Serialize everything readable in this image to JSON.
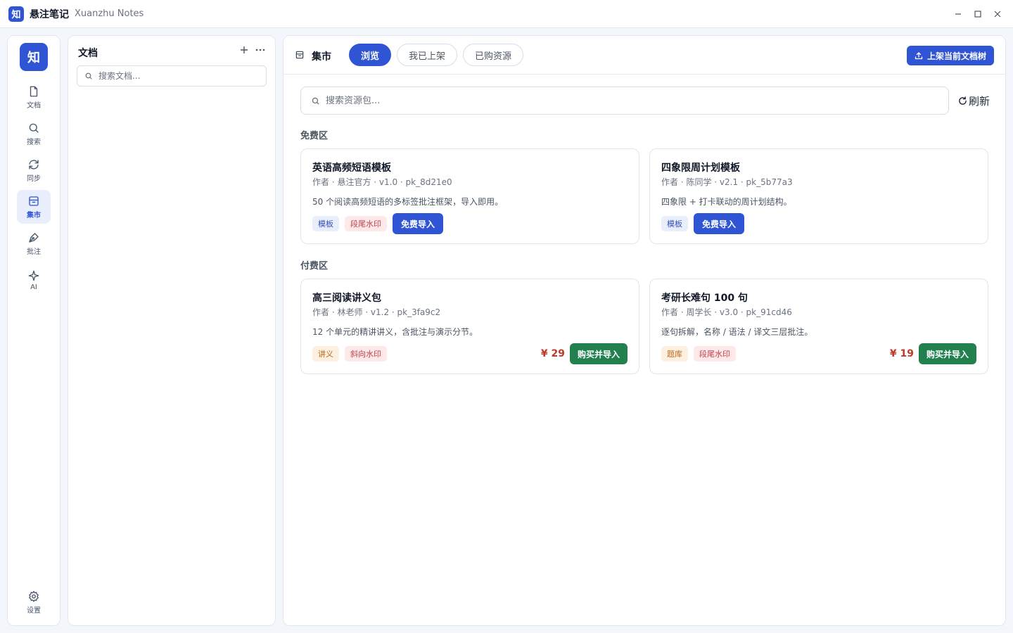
{
  "titlebar": {
    "logo_char": "知",
    "app_name": "悬注笔记",
    "app_subtitle": "Xuanzhu Notes"
  },
  "rail": {
    "logo_char": "知",
    "items": [
      {
        "label": "文档",
        "icon": "document-icon",
        "active": false
      },
      {
        "label": "搜索",
        "icon": "search-icon",
        "active": false
      },
      {
        "label": "同步",
        "icon": "sync-icon",
        "active": false
      },
      {
        "label": "集市",
        "icon": "market-icon",
        "active": true
      },
      {
        "label": "批注",
        "icon": "annotate-pen-icon",
        "active": false
      },
      {
        "label": "AI",
        "icon": "sparkle-icon",
        "active": false
      }
    ],
    "settings_label": "设置"
  },
  "docs": {
    "title": "文档",
    "search_placeholder": "搜索文档..."
  },
  "market": {
    "title": "集市",
    "tabs": [
      {
        "label": "浏览",
        "active": true
      },
      {
        "label": "我已上架",
        "active": false
      },
      {
        "label": "已购资源",
        "active": false
      }
    ],
    "publish_label": "上架当前文档树",
    "search_placeholder": "搜索资源包...",
    "refresh_label": "刷新",
    "free_section": {
      "label": "免费区",
      "cards": [
        {
          "title": "英语高频短语模板",
          "meta": "作者 · 悬注官方 · v1.0 · pk_8d21e0",
          "desc": "50 个阅读高频短语的多标签批注框架，导入即用。",
          "tags": [
            {
              "text": "模板",
              "color": "blue"
            },
            {
              "text": "段尾水印",
              "color": "red"
            }
          ],
          "button": "免费导入"
        },
        {
          "title": "四象限周计划模板",
          "meta": "作者 · 陈同学 · v2.1 · pk_5b77a3",
          "desc": "四象限 + 打卡联动的周计划结构。",
          "tags": [
            {
              "text": "模板",
              "color": "blue"
            }
          ],
          "button": "免费导入"
        }
      ]
    },
    "paid_section": {
      "label": "付费区",
      "cards": [
        {
          "title": "高三阅读讲义包",
          "meta": "作者 · 林老师 · v1.2 · pk_3fa9c2",
          "desc": "12 个单元的精讲讲义，含批注与演示分节。",
          "tags": [
            {
              "text": "讲义",
              "color": "orange"
            },
            {
              "text": "斜向水印",
              "color": "red"
            }
          ],
          "price": "¥ 29",
          "button": "购买并导入"
        },
        {
          "title": "考研长难句 100 句",
          "meta": "作者 · 周学长 · v3.0 · pk_91cd46",
          "desc": "逐句拆解，名称 / 语法 / 译文三层批注。",
          "tags": [
            {
              "text": "题库",
              "color": "orange"
            },
            {
              "text": "段尾水印",
              "color": "red"
            }
          ],
          "price": "¥ 19",
          "button": "购买并导入"
        }
      ]
    }
  },
  "colors": {
    "accent": "#2f55d4",
    "buy_green": "#22804f",
    "price_red": "#c0392b"
  }
}
